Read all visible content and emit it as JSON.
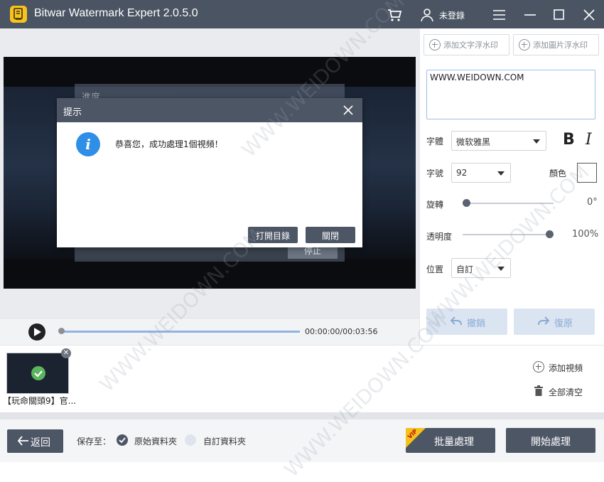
{
  "titlebar": {
    "app_title": "Bitwar Watermark Expert  2.0.5.0",
    "login_label": "未登錄",
    "icons": [
      "cart-icon",
      "user-icon",
      "menu-icon",
      "minimize-icon",
      "maximize-icon",
      "close-icon"
    ]
  },
  "video": {
    "time": "00:00:00/00:03:56",
    "progress": 0
  },
  "background_dialog": {
    "title": "進度",
    "stop_label": "停止"
  },
  "dialog": {
    "title": "提示",
    "message": "恭喜您，成功處理1個視頻！",
    "open_dir_label": "打開目錄",
    "close_label": "關閉"
  },
  "panel": {
    "add_text_wm": "添加文字浮水印",
    "add_image_wm": "添加圖片浮水印",
    "wm_text": "WWW.WEIDOWN.COM",
    "font_label": "字體",
    "font_value": "微软雅黑",
    "size_label": "字號",
    "size_value": "92",
    "color_label": "顏色",
    "color_value": "#ffffff",
    "rotate_label": "旋轉",
    "rotate_value": "0°",
    "rotate_fraction": 0,
    "opacity_label": "透明度",
    "opacity_value": "100%",
    "opacity_fraction": 1,
    "position_label": "位置",
    "position_value": "自訂",
    "undo_label": "撤銷",
    "redo_label": "復原"
  },
  "files": {
    "thumb_caption": "【玩命關頭9】官...",
    "add_video_label": "添加視頻",
    "clear_all_label": "全部清空"
  },
  "footer": {
    "back_label": "返回",
    "save_to_label": "保存至：",
    "original_folder_label": "原始資料夾",
    "custom_folder_label": "自訂資料夾",
    "selected_option": "原始資料夾",
    "batch_label": "批量處理",
    "vip_badge": "VIP",
    "start_label": "開始處理"
  },
  "watermark_overlay": "WWW.WEIDOWN.COM",
  "colors": {
    "titlebar": "#4a5463",
    "accent_blue": "#2f8ee6",
    "success_green": "#5bb45e"
  }
}
